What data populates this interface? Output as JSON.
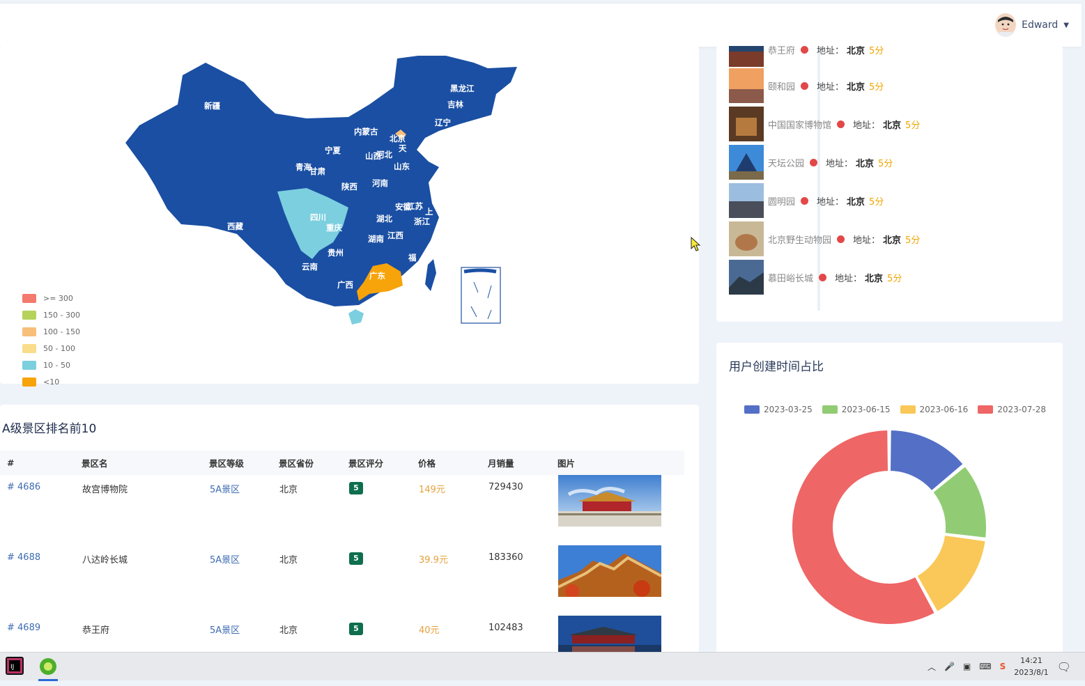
{
  "header": {
    "user_name": "Edward"
  },
  "map": {
    "provinces": [
      "新疆",
      "西藏",
      "内蒙古",
      "黑龙江",
      "吉林",
      "辽宁",
      "北京",
      "天",
      "宁夏",
      "山西",
      "河北",
      "山东",
      "青海",
      "甘肃",
      "陕西",
      "河南",
      "四川",
      "重庆",
      "湖北",
      "安徽",
      "江苏",
      "上",
      "浙江",
      "湖南",
      "江西",
      "贵州",
      "云南",
      "福",
      "广西",
      "广东"
    ],
    "legend": [
      {
        "label": ">= 300",
        "color": "#f47a6d"
      },
      {
        "label": "150 - 300",
        "color": "#b6d25a"
      },
      {
        "label": "100 - 150",
        "color": "#f7bf7a"
      },
      {
        "label": "50 - 100",
        "color": "#f9dd8a"
      },
      {
        "label": "10 - 50",
        "color": "#7ccfdf"
      },
      {
        "label": "<10",
        "color": "#f7a30a"
      }
    ]
  },
  "top10": {
    "title": "A级景区排名前10",
    "columns": [
      "#",
      "景区名",
      "景区等级",
      "景区省份",
      "景区评分",
      "价格",
      "月销量",
      "图片"
    ],
    "rows": [
      {
        "id": "# 4686",
        "name": "故宫博物院",
        "level": "5A景区",
        "province": "北京",
        "score": "5",
        "price": "149元",
        "sales": "729430"
      },
      {
        "id": "# 4688",
        "name": "八达岭长城",
        "level": "5A景区",
        "province": "北京",
        "score": "5",
        "price": "39.9元",
        "sales": "183360"
      },
      {
        "id": "# 4689",
        "name": "恭王府",
        "level": "5A景区",
        "province": "北京",
        "score": "5",
        "price": "40元",
        "sales": "102483"
      }
    ]
  },
  "timeline": {
    "address_label": "地址：",
    "items": [
      {
        "name": "恭王府",
        "city": "北京",
        "score": "5分"
      },
      {
        "name": "颐和园",
        "city": "北京",
        "score": "5分"
      },
      {
        "name": "中国国家博物馆",
        "city": "北京",
        "score": "5分"
      },
      {
        "name": "天坛公园",
        "city": "北京",
        "score": "5分"
      },
      {
        "name": "圆明园",
        "city": "北京",
        "score": "5分"
      },
      {
        "name": "北京野生动物园",
        "city": "北京",
        "score": "5分"
      },
      {
        "name": "慕田峪长城",
        "city": "北京",
        "score": "5分"
      }
    ]
  },
  "chart_data": {
    "type": "pie",
    "title": "用户创建时间占比",
    "legend_position": "top",
    "categories": [
      "2023-03-25",
      "2023-06-15",
      "2023-06-16",
      "2023-07-28"
    ],
    "values": [
      14,
      13,
      15,
      58
    ],
    "colors": [
      "#5470c6",
      "#91cc75",
      "#fac858",
      "#ee6666"
    ]
  },
  "taskbar": {
    "time": "14:21",
    "date": "2023/8/1"
  }
}
